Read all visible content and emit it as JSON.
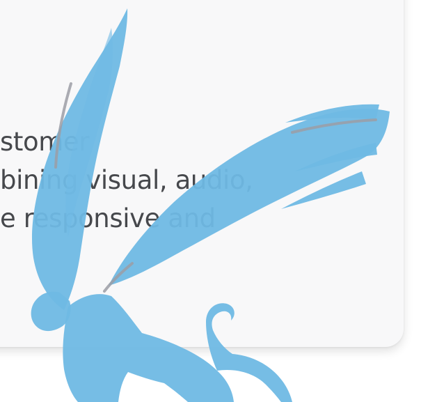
{
  "card": {
    "lines": [
      "stomer",
      "bining visual, audio,",
      "e responsive and"
    ]
  },
  "emblem": {
    "icon": "griffin-logo-icon",
    "color": "#6fb9e4",
    "accent": "#9c9ea6"
  },
  "colors": {
    "background": "#ffffff",
    "card": "#f8f8f9",
    "text": "#46484c"
  }
}
